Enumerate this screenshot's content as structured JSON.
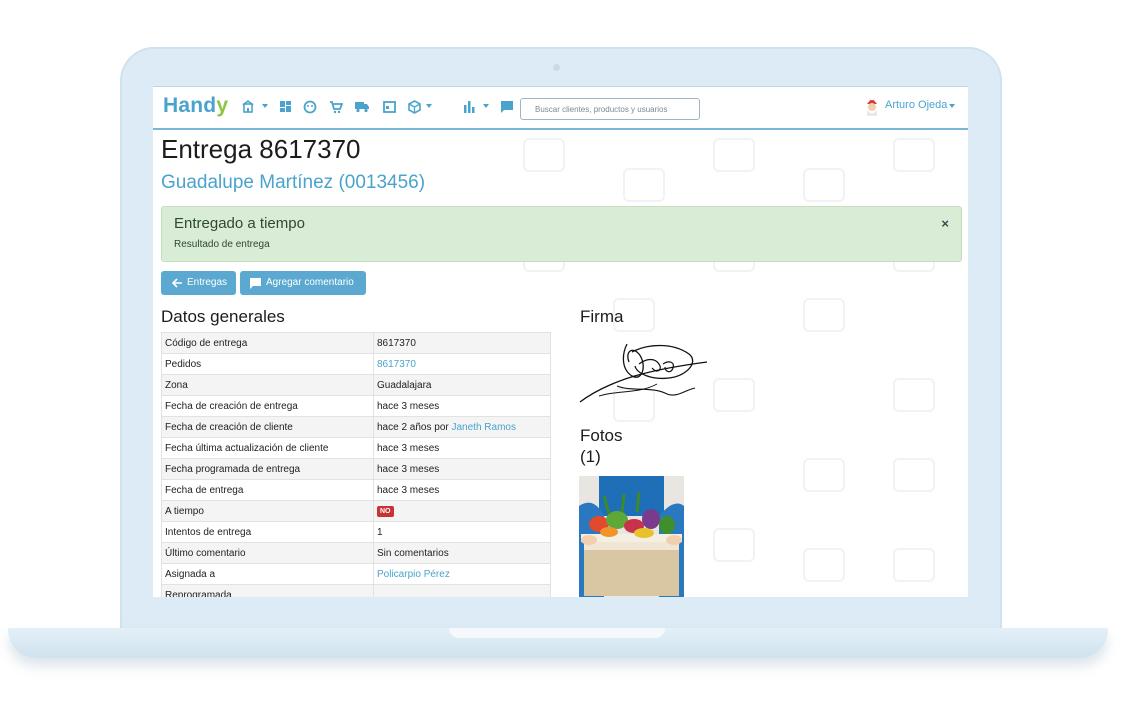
{
  "nav": {
    "logo": "Handy",
    "search_placeholder": "Buscar clientes, productos y usuarios",
    "user_name": "Arturo Ojeda",
    "icons": [
      "store-icon",
      "dashboard-icon",
      "face-icon",
      "cart-icon",
      "truck-icon",
      "calendar-icon",
      "box-icon",
      "bar-chart-icon",
      "comment-icon"
    ]
  },
  "page": {
    "title": "Entrega 8617370",
    "client": "Guadalupe Martínez (0013456)"
  },
  "alert": {
    "title": "Entregado a tiempo",
    "subtitle": "Resultado de entrega",
    "close": "×"
  },
  "actions": {
    "back_label": "Entregas",
    "comment_label": "Agregar comentario"
  },
  "sections": {
    "general": "Datos generales",
    "signature": "Firma",
    "photos": "Fotos",
    "photos_count": "(1)"
  },
  "table": [
    {
      "key": "Código de entrega",
      "value": "8617370"
    },
    {
      "key": "Pedidos",
      "link": "8617370"
    },
    {
      "key": "Zona",
      "value": "Guadalajara"
    },
    {
      "key": "Fecha de creación de entrega",
      "value": "hace 3 meses"
    },
    {
      "key": "Fecha de creación de cliente",
      "value": "hace 2 años por",
      "link": "Janeth Ramos"
    },
    {
      "key": "Fecha última actualización de cliente",
      "value": "hace 3 meses"
    },
    {
      "key": "Fecha programada de entrega",
      "value": "hace 3 meses"
    },
    {
      "key": "Fecha de entrega",
      "value": "hace 3 meses"
    },
    {
      "key": "A tiempo",
      "badge": "NO"
    },
    {
      "key": "Intentos de entrega",
      "value": "1"
    },
    {
      "key": "Último comentario",
      "value": "Sin comentarios"
    },
    {
      "key": "Asignada a",
      "link": "Policarpio Pérez"
    },
    {
      "key": "Reprogramada",
      "value": ""
    }
  ],
  "colors": {
    "accent": "#4aa3cc",
    "success_bg": "#d9ecd6",
    "button": "#5ba9d1",
    "badge": "#c73434"
  }
}
